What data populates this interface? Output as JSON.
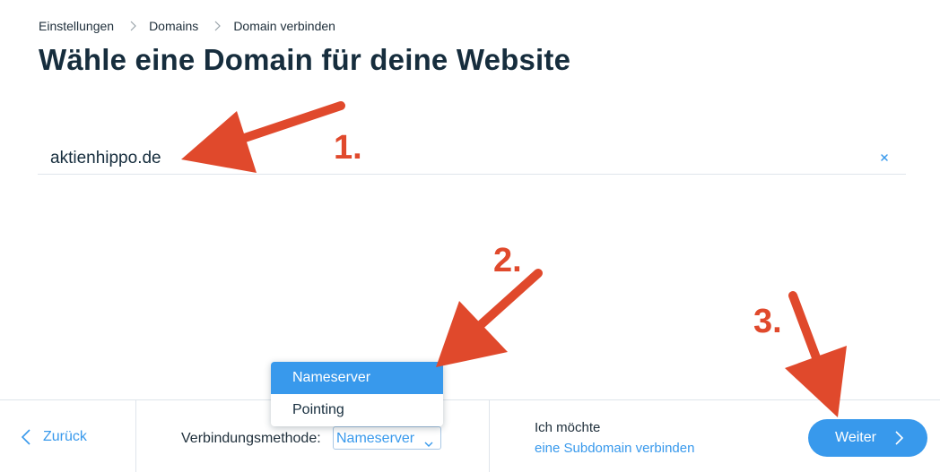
{
  "breadcrumb": {
    "items": [
      "Einstellungen",
      "Domains",
      "Domain verbinden"
    ]
  },
  "page_title": "Wähle eine Domain für deine Website",
  "domain_input": {
    "value": "aktienhippo.de"
  },
  "footer": {
    "back_label": "Zurück",
    "method_label": "Verbindungsmethode:",
    "method_selected": "Nameserver",
    "subdomain_prefix": "Ich möchte",
    "subdomain_link": "eine Subdomain verbinden",
    "next_label": "Weiter"
  },
  "dropdown": {
    "options": [
      "Nameserver",
      "Pointing"
    ],
    "selected_index": 0
  },
  "annotations": {
    "labels": [
      "1.",
      "2.",
      "3."
    ],
    "arrow_color": "#e0492c"
  },
  "colors": {
    "accent": "#3899ec",
    "text": "#162d3d",
    "divider": "#dfe5eb"
  },
  "icons": [
    "chevron-right-icon",
    "clear-icon",
    "chevron-left-icon",
    "chevron-down-icon"
  ]
}
